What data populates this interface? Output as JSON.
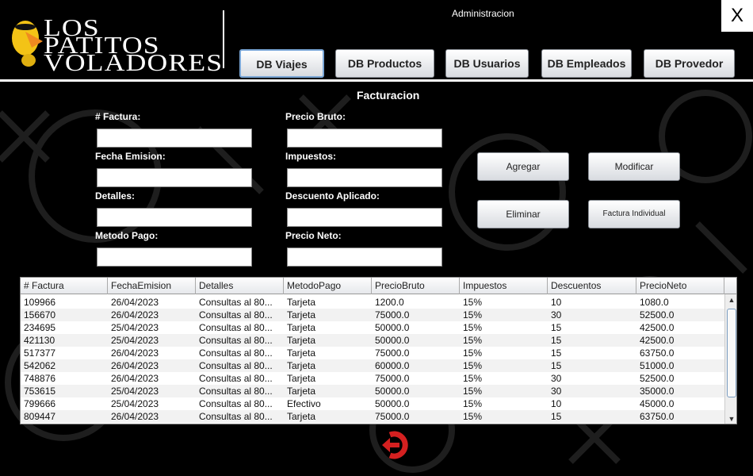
{
  "header": {
    "logo_text": [
      "LOS",
      "PATITOS",
      "VOLADORES"
    ],
    "admin_label": "Administracion",
    "close_label": "X",
    "nav": [
      {
        "label": "DB Viajes",
        "active": true
      },
      {
        "label": "DB Productos"
      },
      {
        "label": "DB Usuarios"
      },
      {
        "label": "DB Empleados"
      },
      {
        "label": "DB Provedor"
      }
    ]
  },
  "form": {
    "title": "Facturacion",
    "fields": [
      {
        "label": "# Factura:",
        "value": ""
      },
      {
        "label": "Fecha Emision:",
        "value": ""
      },
      {
        "label": "Detalles:",
        "value": ""
      },
      {
        "label": "Metodo Pago:",
        "value": ""
      },
      {
        "label": "Precio Bruto:",
        "value": ""
      },
      {
        "label": "Impuestos:",
        "value": ""
      },
      {
        "label": "Descuento Aplicado:",
        "value": ""
      },
      {
        "label": "Precio Neto:",
        "value": ""
      }
    ],
    "buttons": {
      "add": "Agregar",
      "modify": "Modificar",
      "delete": "Eliminar",
      "invoice": "Factura Individual"
    }
  },
  "table": {
    "columns": [
      "# Factura",
      "FechaEmision",
      "Detalles",
      "MetodoPago",
      "PrecioBruto",
      "Impuestos",
      "Descuentos",
      "PrecioNeto"
    ],
    "rows": [
      [
        "109966",
        "26/04/2023",
        "Consultas al 80...",
        "Tarjeta",
        "1200.0",
        "15%",
        "10",
        "1080.0"
      ],
      [
        "156670",
        "26/04/2023",
        "Consultas al 80...",
        "Tarjeta",
        "75000.0",
        "15%",
        "30",
        "52500.0"
      ],
      [
        "234695",
        "25/04/2023",
        "Consultas al 80...",
        "Tarjeta",
        "50000.0",
        "15%",
        "15",
        "42500.0"
      ],
      [
        "421130",
        "25/04/2023",
        "Consultas al 80...",
        "Tarjeta",
        "50000.0",
        "15%",
        "15",
        "42500.0"
      ],
      [
        "517377",
        "26/04/2023",
        "Consultas al 80...",
        "Tarjeta",
        "75000.0",
        "15%",
        "15",
        "63750.0"
      ],
      [
        "542062",
        "26/04/2023",
        "Consultas al 80...",
        "Tarjeta",
        "60000.0",
        "15%",
        "15",
        "51000.0"
      ],
      [
        "748876",
        "26/04/2023",
        "Consultas al 80...",
        "Tarjeta",
        "75000.0",
        "15%",
        "30",
        "52500.0"
      ],
      [
        "753615",
        "25/04/2023",
        "Consultas al 80...",
        "Tarjeta",
        "50000.0",
        "15%",
        "30",
        "35000.0"
      ],
      [
        "799666",
        "25/04/2023",
        "Consultas al 80...",
        "Efectivo",
        "50000.0",
        "15%",
        "10",
        "45000.0"
      ],
      [
        "809447",
        "26/04/2023",
        "Consultas al 80...",
        "Tarjeta",
        "75000.0",
        "15%",
        "15",
        "63750.0"
      ]
    ]
  },
  "colors": {
    "logout": "#d42020",
    "background": "#000000"
  },
  "icons": {
    "logout": "logout-icon",
    "logo": "duck-logo"
  }
}
